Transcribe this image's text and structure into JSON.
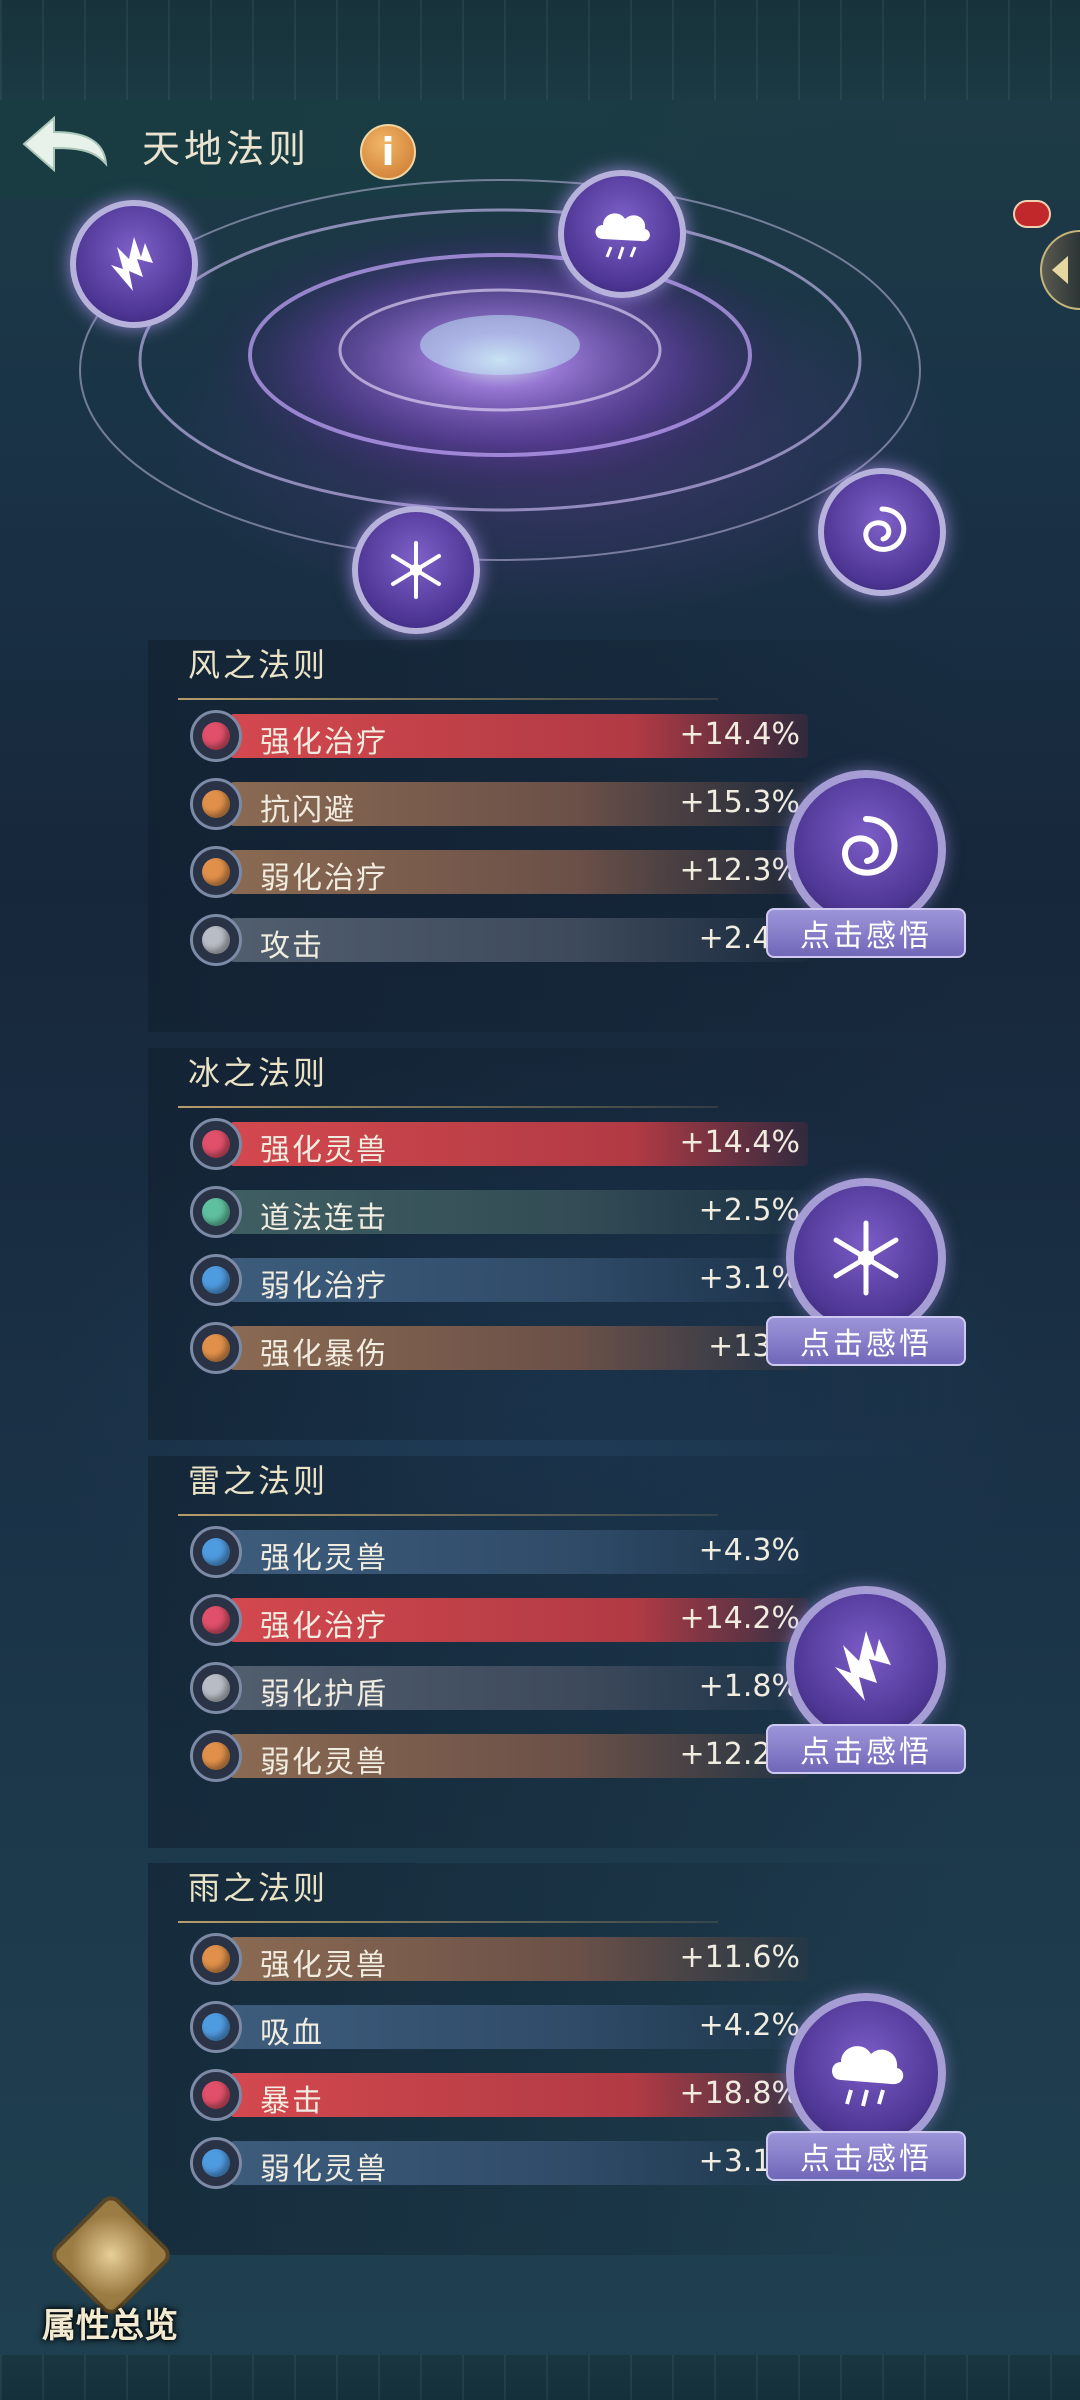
{
  "header": {
    "title": "天地法则",
    "info_icon_text": "i"
  },
  "laws": [
    {
      "title": "风之法则",
      "element_icon": "wind-swirl-icon",
      "button_label": "点击感悟",
      "stats": [
        {
          "name": "强化治疗",
          "value": "+14.4%",
          "tier": "red"
        },
        {
          "name": "抗闪避",
          "value": "+15.3%",
          "tier": "orange"
        },
        {
          "name": "弱化治疗",
          "value": "+12.3%",
          "tier": "orange"
        },
        {
          "name": "攻击",
          "value": "+2.4%",
          "tier": "gray"
        }
      ]
    },
    {
      "title": "冰之法则",
      "element_icon": "snowflake-icon",
      "button_label": "点击感悟",
      "stats": [
        {
          "name": "强化灵兽",
          "value": "+14.4%",
          "tier": "red"
        },
        {
          "name": "道法连击",
          "value": "+2.5%",
          "tier": "teal"
        },
        {
          "name": "弱化治疗",
          "value": "+3.1%",
          "tier": "blue"
        },
        {
          "name": "强化暴伤",
          "value": "+13%",
          "tier": "orange"
        }
      ]
    },
    {
      "title": "雷之法则",
      "element_icon": "lightning-icon",
      "button_label": "点击感悟",
      "stats": [
        {
          "name": "强化灵兽",
          "value": "+4.3%",
          "tier": "blue"
        },
        {
          "name": "强化治疗",
          "value": "+14.2%",
          "tier": "red"
        },
        {
          "name": "弱化护盾",
          "value": "+1.8%",
          "tier": "gray"
        },
        {
          "name": "弱化灵兽",
          "value": "+12.2%",
          "tier": "orange"
        }
      ]
    },
    {
      "title": "雨之法则",
      "element_icon": "rain-cloud-icon",
      "button_label": "点击感悟",
      "stats": [
        {
          "name": "强化灵兽",
          "value": "+11.6%",
          "tier": "orange"
        },
        {
          "name": "吸血",
          "value": "+4.2%",
          "tier": "blue"
        },
        {
          "name": "暴击",
          "value": "+18.8%",
          "tier": "red"
        },
        {
          "name": "弱化灵兽",
          "value": "+3.1%",
          "tier": "blue"
        }
      ]
    }
  ],
  "tier_colors": {
    "red": "#e0506a",
    "orange": "#e0904a",
    "blue": "#4f9be0",
    "gray": "#b8bcc4",
    "teal": "#5fc0a0"
  },
  "footer": {
    "overview_label": "属性总览"
  }
}
